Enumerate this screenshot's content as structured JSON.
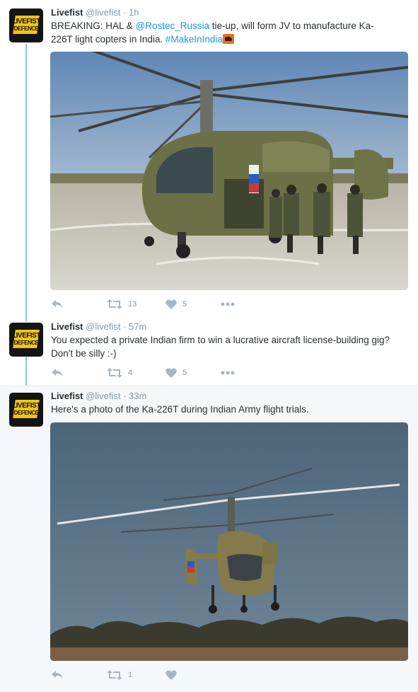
{
  "tweets": [
    {
      "name": "Livefist",
      "handle": "@livefist",
      "time": "· 1h",
      "text_parts": [
        "BREAKING: HAL & ",
        "@Rostec_Russia",
        " tie-up, will form JV to manufacture Ka-226T light copters in India. ",
        "#MakeInIndia"
      ],
      "retweets": "13",
      "likes": "5"
    },
    {
      "name": "Livefist",
      "handle": "@livefist",
      "time": "· 57m",
      "text": "You expected a private Indian firm to win a lucrative aircraft license-building gig? Don't be silly :-)",
      "retweets": "4",
      "likes": "5"
    },
    {
      "name": "Livefist",
      "handle": "@livefist",
      "time": "· 33m",
      "text": "Here's a photo of the Ka-226T during Indian Army flight trials.",
      "retweets": "1",
      "likes": ""
    }
  ],
  "avatar": {
    "line1": "LIVEFIST",
    "line2": "DEFENCE"
  },
  "colors": {
    "accent": "#1b95e0",
    "thread": "#90c8ea",
    "icon": "#a8b6c2",
    "logo_yellow": "#f2c318"
  },
  "icons": [
    "reply-icon",
    "retweet-icon",
    "heart-icon",
    "more-icon"
  ]
}
